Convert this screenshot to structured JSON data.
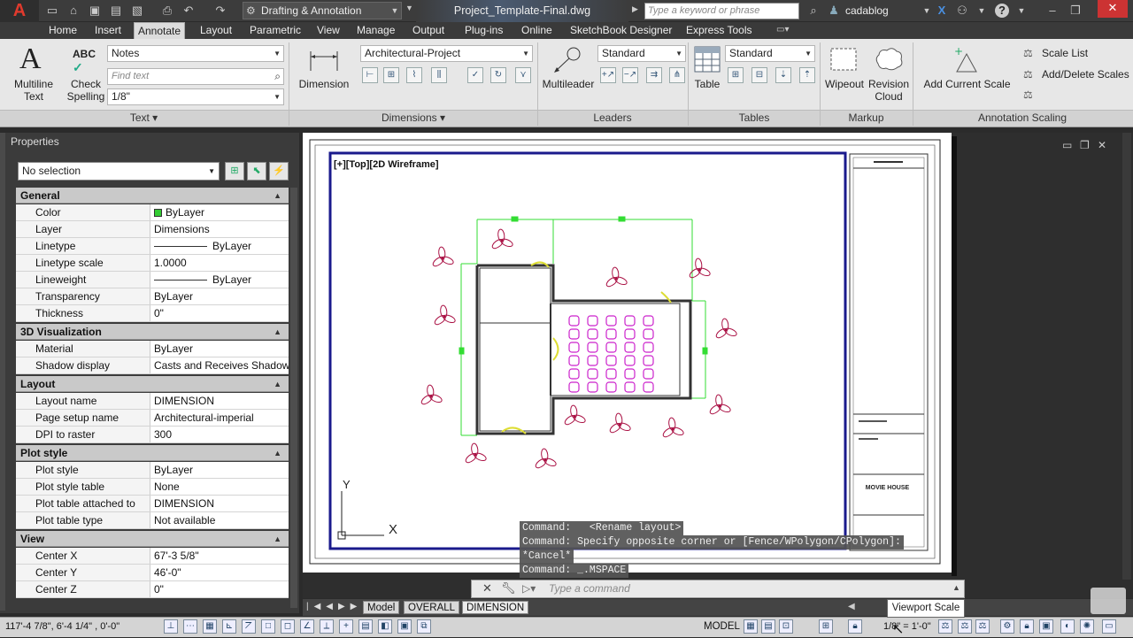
{
  "title_bar": {
    "workspace": "Drafting & Annotation",
    "file_title": "Project_Template-Final.dwg",
    "search_placeholder": "Type a keyword or phrase",
    "user": "cadablog"
  },
  "menu_tabs": [
    "Home",
    "Insert",
    "Annotate",
    "Layout",
    "Parametric",
    "View",
    "Manage",
    "Output",
    "Plug-ins",
    "Online",
    "SketchBook Designer",
    "Express Tools"
  ],
  "active_tab": "Annotate",
  "ribbon": {
    "text_panel": {
      "title": "Text",
      "multiline_text": "Multiline\nText",
      "check_spelling": "Check\nSpelling",
      "text_style": "Notes",
      "find_placeholder": "Find text",
      "text_height": "1/8\""
    },
    "dimensions_panel": {
      "title": "Dimensions",
      "dimension_label": "Dimension",
      "dim_style": "Architectural-Project"
    },
    "leaders_panel": {
      "title": "Leaders",
      "multileader_label": "Multileader",
      "leader_style": "Standard"
    },
    "tables_panel": {
      "title": "Tables",
      "table_label": "Table",
      "table_style": "Standard"
    },
    "markup_panel": {
      "title": "Markup",
      "wipeout": "Wipeout",
      "revision_cloud": "Revision\nCloud"
    },
    "annotation_scaling_panel": {
      "title": "Annotation Scaling",
      "add_current_scale": "Add Current Scale",
      "scale_list": "Scale List",
      "add_delete_scales": "Add/Delete Scales"
    }
  },
  "properties": {
    "title": "Properties",
    "selection": "No selection",
    "sections": [
      {
        "name": "General",
        "rows": [
          {
            "k": "Color",
            "v": "ByLayer",
            "swatch": "#33cc33"
          },
          {
            "k": "Layer",
            "v": "Dimensions"
          },
          {
            "k": "Linetype",
            "v": "ByLayer",
            "line": true
          },
          {
            "k": "Linetype scale",
            "v": "1.0000"
          },
          {
            "k": "Lineweight",
            "v": "ByLayer",
            "line": true
          },
          {
            "k": "Transparency",
            "v": "ByLayer"
          },
          {
            "k": "Thickness",
            "v": "0\""
          }
        ]
      },
      {
        "name": "3D Visualization",
        "rows": [
          {
            "k": "Material",
            "v": "ByLayer"
          },
          {
            "k": "Shadow display",
            "v": "Casts and Receives Shadows"
          }
        ]
      },
      {
        "name": "Layout",
        "rows": [
          {
            "k": "Layout name",
            "v": "DIMENSION"
          },
          {
            "k": "Page setup name",
            "v": "Architectural-imperial"
          },
          {
            "k": "DPI to raster",
            "v": "300"
          }
        ]
      },
      {
        "name": "Plot style",
        "rows": [
          {
            "k": "Plot style",
            "v": "ByLayer"
          },
          {
            "k": "Plot style table",
            "v": "None"
          },
          {
            "k": "Plot table attached to",
            "v": "DIMENSION"
          },
          {
            "k": "Plot table type",
            "v": "Not available"
          }
        ]
      },
      {
        "name": "View",
        "rows": [
          {
            "k": "Center X",
            "v": "67'-3 5/8\""
          },
          {
            "k": "Center Y",
            "v": "46'-0\""
          },
          {
            "k": "Center Z",
            "v": "0\""
          }
        ]
      }
    ]
  },
  "viewport_label": "[+][Top][2D Wireframe]",
  "title_block_text": "MOVIE HOUSE",
  "ucs": {
    "y": "Y",
    "x": "X"
  },
  "command_history": [
    "Command:   <Rename layout>",
    "Command: Specify opposite corner or [Fence/WPolygon/CPolygon]:",
    "*Cancel*",
    "Command: _.MSPACE"
  ],
  "command_placeholder": "Type a command",
  "layout_tabs": [
    "Model",
    "OVERALL",
    "DIMENSION"
  ],
  "active_layout": "DIMENSION",
  "status": {
    "coords": "117'-4 7/8\", 6'-4 1/4\" , 0'-0\"",
    "model": "MODEL",
    "scale": "1/8\" = 1'-0\"",
    "tooltip": "Viewport Scale"
  },
  "colors": {
    "viewport_border": "#1a1a8c",
    "dimension_green": "#33dd33",
    "seats_magenta": "#cc22cc",
    "plants_red": "#aa1144",
    "walls": "#333333"
  }
}
